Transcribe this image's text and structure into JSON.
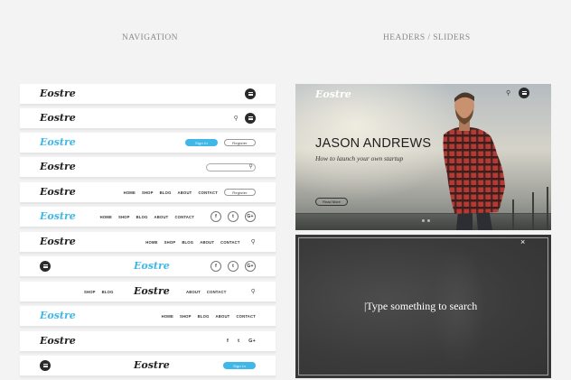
{
  "sections": {
    "navigation": "NAVIGATION",
    "headers": "HEADERS / SLIDERS"
  },
  "logo": "Eostre",
  "nav": {
    "home": "HOME",
    "shop": "SHOP",
    "blog": "BLOG",
    "about": "ABOUT",
    "contact": "CONTACT",
    "sign_in": "Sign In",
    "register": "Register"
  },
  "social": {
    "facebook": "f",
    "twitter": "t",
    "google": "G+"
  },
  "hero": {
    "name": "JASON ANDREWS",
    "subtitle": "How to launch your own startup",
    "read_more": "Read More"
  },
  "search_overlay": {
    "placeholder": "Type something to search",
    "close": "×"
  },
  "colors": {
    "accent": "#3fb8e8",
    "dark": "#2a2a2a",
    "overlay": "#3b3b3b"
  }
}
